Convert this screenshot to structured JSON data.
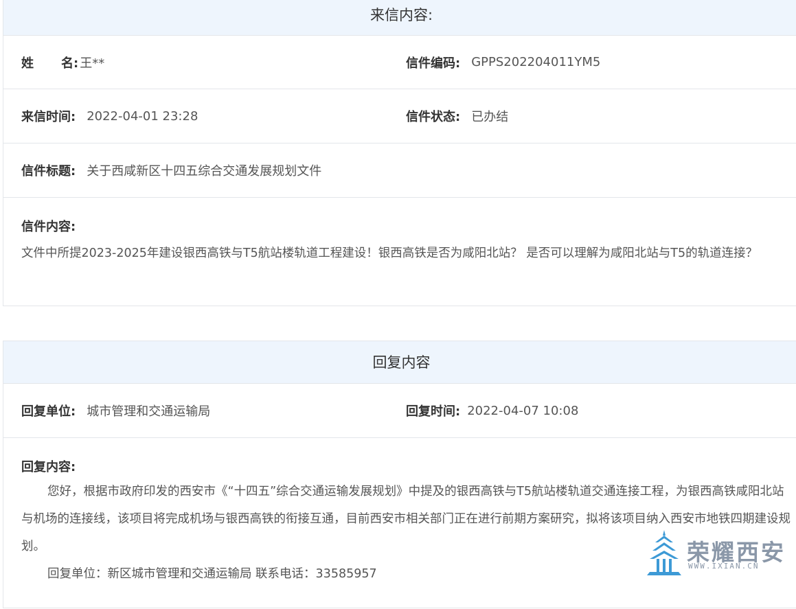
{
  "letter": {
    "header": "来信内容:",
    "name_label_a": "姓",
    "name_label_b": "名:",
    "name_value": "王**",
    "code_label": "信件编码:",
    "code_value": "GPPS202204011YM5",
    "time_label": "来信时间:",
    "time_value": "2022-04-01 23:28",
    "status_label": "信件状态:",
    "status_value": "已办结",
    "title_label": "信件标题:",
    "title_value": "关于西咸新区十四五综合交通发展规划文件",
    "content_label": "信件内容:",
    "content_value": "文件中所提2023-2025年建设银西高铁与T5航站楼轨道工程建设！银西高铁是否为咸阳北站？ 是否可以理解为咸阳北站与T5的轨道连接？"
  },
  "reply": {
    "header": "回复内容",
    "unit_label": "回复单位:",
    "unit_value": "城市管理和交通运输局",
    "time_label": "回复时间:",
    "time_value": "2022-04-07 10:08",
    "content_label": "回复内容:",
    "content_value": "您好，根据市政府印发的西安市《“十四五”综合交通运输发展规划》中提及的银西高铁与T5航站楼轨道交通连接工程，为银西高铁咸阳北站与机场的连接线，该项目将完成机场与银西高铁的衔接互通，目前西安市相关部门正在进行前期方案研究，拟将该项目纳入西安市地铁四期建设规划。",
    "sign_value": "回复单位：新区城市管理和交通运输局  联系电话：33585957"
  },
  "watermark": {
    "brand": "荣耀西安",
    "url": "WWW.IXIAN.CN",
    "icon": "building-tower-icon",
    "color": "#8a97a8"
  }
}
